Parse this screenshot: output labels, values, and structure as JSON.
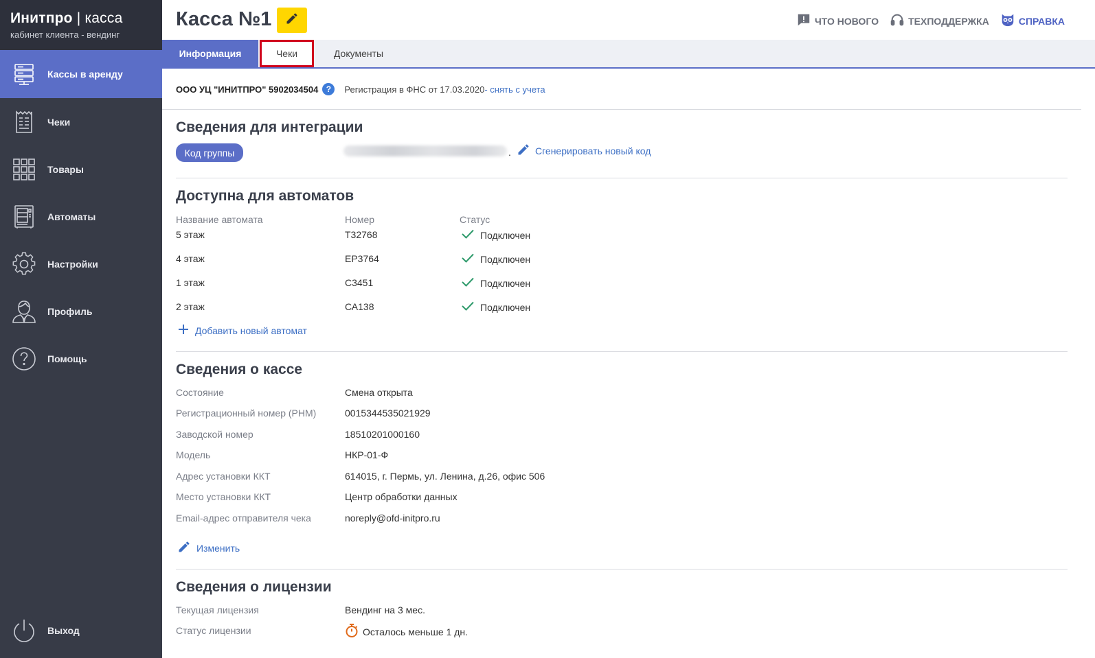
{
  "brand": {
    "title_bold": "Инитпро",
    "title_sep": " | ",
    "title_thin": "касса",
    "subtitle": "кабинет клиента - вендинг"
  },
  "sidebar": {
    "items": [
      {
        "label": "Кассы в аренду",
        "icon": "server-icon",
        "active": true
      },
      {
        "label": "Чеки",
        "icon": "receipt-icon",
        "active": false
      },
      {
        "label": "Товары",
        "icon": "grid-icon",
        "active": false
      },
      {
        "label": "Автоматы",
        "icon": "vending-machine-icon",
        "active": false
      },
      {
        "label": "Настройки",
        "icon": "gear-icon",
        "active": false
      },
      {
        "label": "Профиль",
        "icon": "user-icon",
        "active": false
      },
      {
        "label": "Помощь",
        "icon": "help-circle-icon",
        "active": false
      }
    ],
    "logout": {
      "label": "Выход",
      "icon": "power-icon"
    }
  },
  "header": {
    "title": "Касса №1",
    "links": [
      {
        "label": "Что нового",
        "icon": "chat-alert-icon"
      },
      {
        "label": "Техподдержка",
        "icon": "headset-icon"
      },
      {
        "label": "Справка",
        "icon": "owl-icon"
      }
    ]
  },
  "tabs": [
    {
      "label": "Информация",
      "active": true
    },
    {
      "label": "Чеки",
      "active": false
    },
    {
      "label": "Документы",
      "active": false
    }
  ],
  "org": {
    "name": "ООО УЦ \"ИНИТПРО\" 5902034504",
    "registration": "Регистрация в ФНС от 17.03.2020",
    "deregister_link": " - снять с учета"
  },
  "integration": {
    "title": "Сведения для интеграции",
    "group_button": "Код группы",
    "code_suffix": ".",
    "generate_link": "Сгенерировать новый код"
  },
  "machines": {
    "title": "Доступна для автоматов",
    "columns": [
      "Название автомата",
      "Номер",
      "Статус"
    ],
    "rows": [
      {
        "name": "5 этаж",
        "number": "Т32768",
        "status": "Подключен"
      },
      {
        "name": "4 этаж",
        "number": "ЕР3764",
        "status": "Подключен"
      },
      {
        "name": "1 этаж",
        "number": "С3451",
        "status": "Подключен"
      },
      {
        "name": "2 этаж",
        "number": "СА138",
        "status": "Подключен"
      }
    ],
    "add_link": "Добавить новый автомат"
  },
  "kkt": {
    "title": "Сведения о кассе",
    "fields": [
      {
        "label": "Состояние",
        "value": "Смена открыта"
      },
      {
        "label": "Регистрационный номер (РНМ)",
        "value": "0015344535021929"
      },
      {
        "label": "Заводской номер",
        "value": "18510201000160"
      },
      {
        "label": "Модель",
        "value": "НКР-01-Ф"
      },
      {
        "label": "Адрес установки ККТ",
        "value": "614015, г. Пермь, ул. Ленина, д.26, офис 506"
      },
      {
        "label": "Место установки ККТ",
        "value": "Центр обработки данных"
      },
      {
        "label": "Email-адрес отправителя чека",
        "value": "noreply@ofd-initpro.ru"
      }
    ],
    "edit_link": "Изменить"
  },
  "license": {
    "title": "Сведения о лицензии",
    "fields": [
      {
        "label": "Текущая лицензия",
        "value": "Вендинг на 3 мес."
      },
      {
        "label": "Статус лицензии",
        "value": "Осталось меньше 1 дн."
      }
    ]
  },
  "colors": {
    "sidebar_bg": "#373b47",
    "accent": "#5b6ec7",
    "highlight": "#d0021b",
    "edit_yellow": "#ffd600",
    "success": "#2e9a6b",
    "timer": "#e06a1b"
  }
}
